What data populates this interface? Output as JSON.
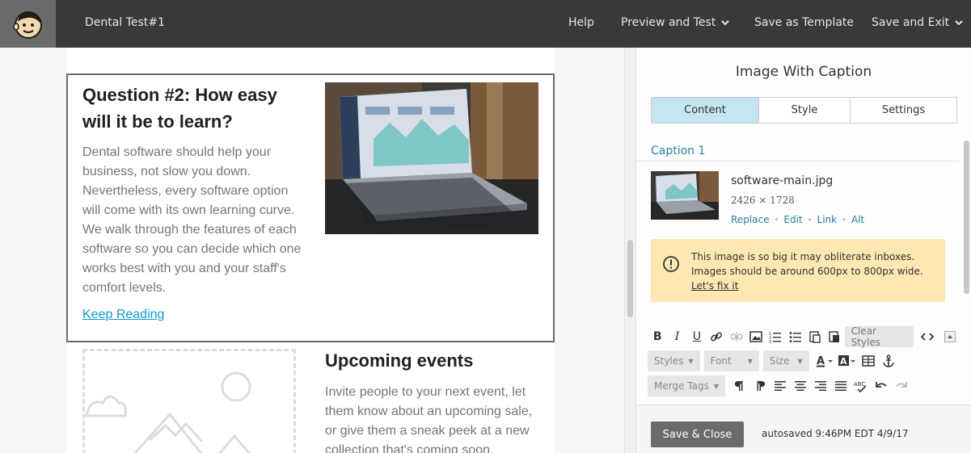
{
  "header": {
    "campaign_name": "Dental Test#1",
    "help_label": "Help",
    "preview_label": "Preview and Test",
    "save_template_label": "Save as Template",
    "save_exit_label": "Save and Exit",
    "logo_icon": "mailchimp-freddie-icon"
  },
  "canvas": {
    "question": {
      "title": "Question #2: How easy will it be to learn?",
      "body": "Dental software should help your business, not slow you down. Nevertheless, every software option will come with its own learning curve. We walk through the features of each software so you can decide which one works best with you and your staff's comfort levels.",
      "link": "Keep Reading"
    },
    "events": {
      "title": "Upcoming events",
      "body": "Invite people to your next event, let them know about an upcoming sale, or give them a sneak peek at a new collection that's coming soon."
    }
  },
  "panel": {
    "title": "Image With Caption",
    "tabs": [
      {
        "label": "Content",
        "active": true
      },
      {
        "label": "Style",
        "active": false
      },
      {
        "label": "Settings",
        "active": false
      }
    ],
    "section_label": "Caption 1",
    "file": {
      "name": "software-main.jpg",
      "dimensions": "2426 × 1728",
      "actions": [
        "Replace",
        "Edit",
        "Link",
        "Alt"
      ]
    },
    "warning": {
      "text": "This image is so big it may obliterate inboxes. Images should be around 600px to 800px wide.",
      "link": "Let's fix it",
      "color": "#fde8b2"
    },
    "toolbar": {
      "clear_styles": "Clear Styles",
      "styles": "Styles",
      "font": "Font",
      "size": "Size",
      "merge_tags": "Merge Tags"
    },
    "footer": {
      "save_close": "Save & Close",
      "autosaved": "autosaved 9:46PM EDT 4/9/17"
    }
  },
  "colors": {
    "accent": "#2b7fa0",
    "link": "#0e9ad1",
    "tab_active": "#c5e5f1",
    "header_bg": "#393939"
  }
}
